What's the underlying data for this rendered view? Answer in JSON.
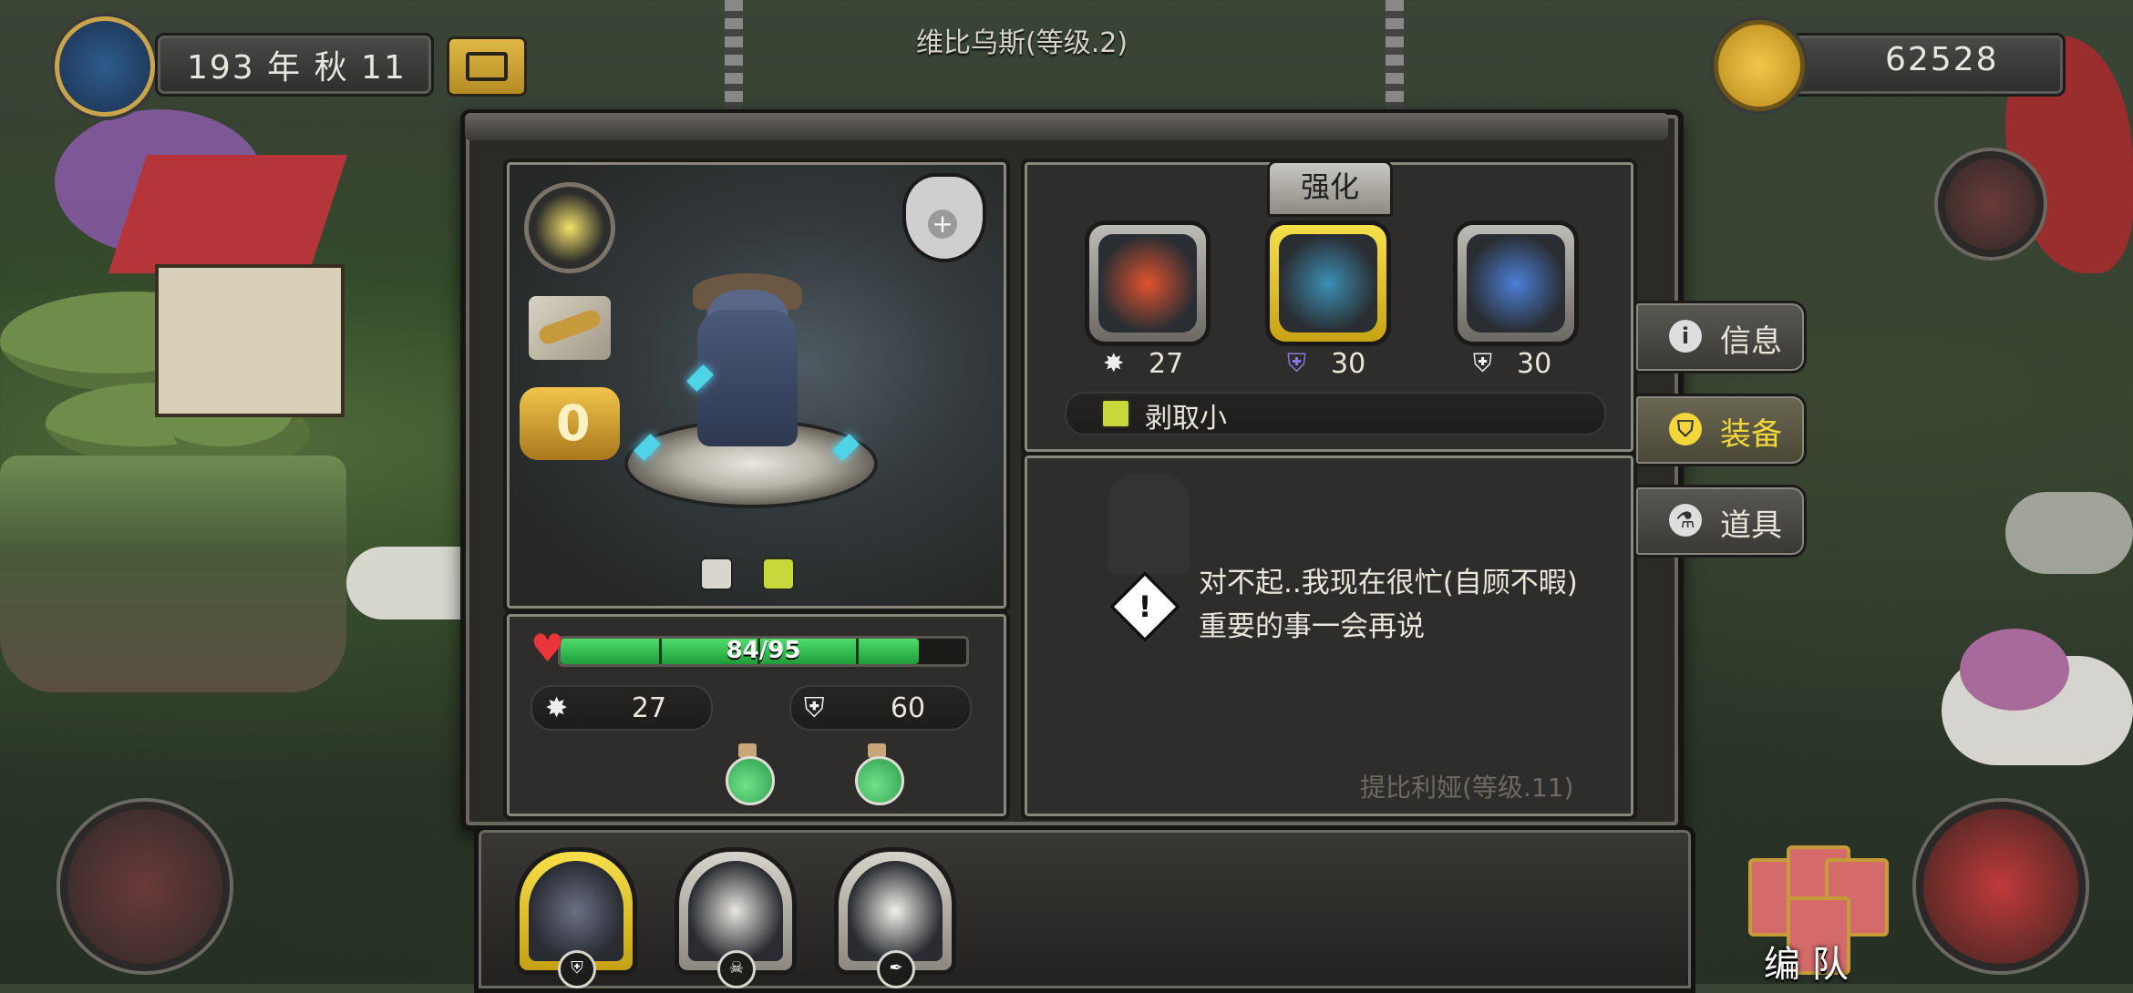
{
  "top_left": {
    "date_text": "193 年 秋 11"
  },
  "header": {
    "title": "维比乌斯(等级.2)"
  },
  "top_right": {
    "gold": "62528"
  },
  "hero": {
    "hp_text": "84/95",
    "hp_fraction": 0.884,
    "attack": "27",
    "defense": "60",
    "level_badge": "0"
  },
  "equipment": {
    "tab_label": "强化",
    "slots": [
      {
        "name": "weapon",
        "stat_value": "27"
      },
      {
        "name": "gloves",
        "stat_value": "30"
      },
      {
        "name": "boots",
        "stat_value": "30"
      }
    ],
    "skill_label": "剥取小"
  },
  "message": {
    "text": "对不起..我现在很忙(自顾不暇)重要的事一会再说",
    "faded_label": "提比利娅(等级.11)"
  },
  "side_menu": [
    {
      "label": "信息",
      "icon": "info-icon",
      "active": false
    },
    {
      "label": "装备",
      "icon": "helmet-icon",
      "active": true
    },
    {
      "label": "道具",
      "icon": "potion-icon",
      "active": false
    }
  ],
  "team": {
    "button_label": "编 队"
  },
  "colors": {
    "accent": "#f2d63a",
    "hp": "#2fbf4f",
    "panel": "#2e2d2b"
  }
}
